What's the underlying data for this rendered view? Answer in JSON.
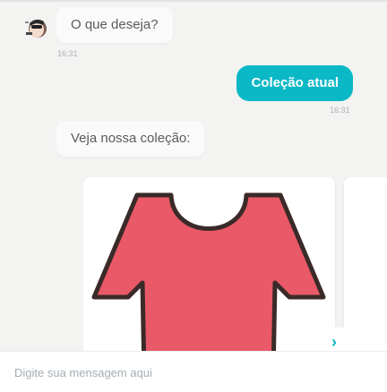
{
  "chat": {
    "messages": [
      {
        "from": "bot",
        "text": "O que deseja?",
        "time": "16:31"
      },
      {
        "from": "user",
        "text": "Coleção atual",
        "time": "16:31"
      },
      {
        "from": "bot",
        "text": "Veja nossa coleção:"
      }
    ],
    "carousel": {
      "next_label": "›",
      "product_color": "#ea5968",
      "outline_color": "#3a2a28"
    }
  },
  "composer": {
    "placeholder": "Digite sua mensagem aqui"
  },
  "colors": {
    "accent": "#0bb8c6",
    "background": "#f3f3f2",
    "bubble_bot": "#fafafa"
  }
}
